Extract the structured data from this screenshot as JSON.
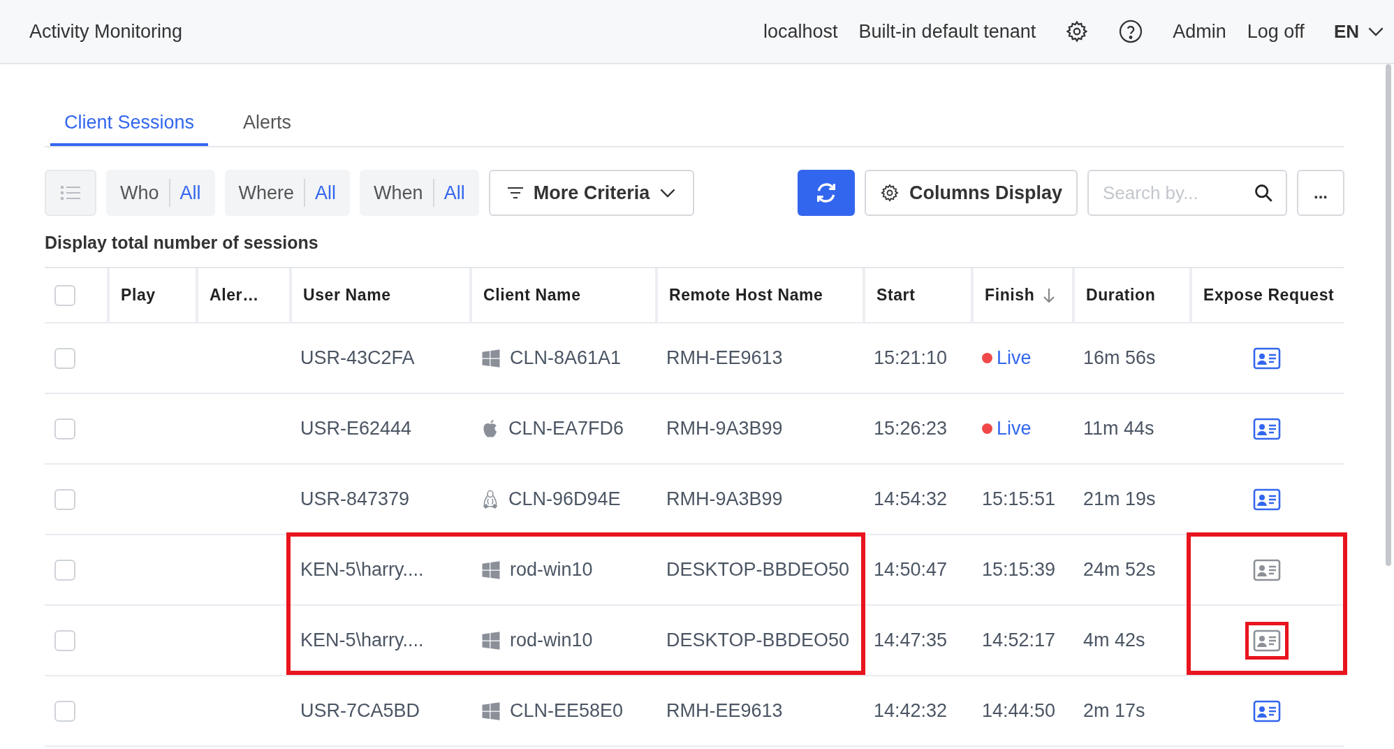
{
  "header": {
    "title": "Activity Monitoring",
    "host": "localhost",
    "tenant": "Built-in default tenant",
    "user": "Admin",
    "logoff": "Log off",
    "language": "EN"
  },
  "tabs": [
    {
      "label": "Client Sessions",
      "selected": true
    },
    {
      "label": "Alerts",
      "selected": false
    }
  ],
  "toolbar": {
    "filters": [
      {
        "label": "Who",
        "value": "All"
      },
      {
        "label": "Where",
        "value": "All"
      },
      {
        "label": "When",
        "value": "All"
      }
    ],
    "more_criteria": "More Criteria",
    "columns_display": "Columns Display",
    "search": {
      "placeholder": "Search by..."
    },
    "more": "..."
  },
  "summary": "Display total number of sessions",
  "table": {
    "select_all": {
      "checked": false
    },
    "columns": [
      {
        "kind": "play",
        "label": "Play",
        "framed": false
      },
      {
        "kind": "alert",
        "label": "Aler…",
        "framed": false
      },
      {
        "kind": "user",
        "label": "User Name",
        "framed": true
      },
      {
        "kind": "client",
        "label": "Client Name",
        "framed": true
      },
      {
        "kind": "remote",
        "label": "Remote Host Name",
        "framed": true
      },
      {
        "kind": "start",
        "label": "Start",
        "framed": false
      },
      {
        "kind": "finish",
        "label": "Finish",
        "sorted": true,
        "framed": false
      },
      {
        "kind": "duration",
        "label": "Duration",
        "framed": false
      },
      {
        "kind": "expose",
        "label": "Expose Request",
        "framed": true
      }
    ],
    "rows": [
      {
        "checked": false,
        "user": "USR-43C2FA",
        "kind": "windows",
        "client": "CLN-8A61A1",
        "remote": "RMH-EE9613",
        "start": "15:21:10",
        "finish": "Live",
        "live": true,
        "duration": "16m 56s",
        "expose_enabled": true,
        "framed": false,
        "icon_framed": false
      },
      {
        "checked": false,
        "user": "USR-E62444",
        "kind": "apple",
        "client": "CLN-EA7FD6",
        "remote": "RMH-9A3B99",
        "start": "15:26:23",
        "finish": "Live",
        "live": true,
        "duration": "11m 44s",
        "expose_enabled": true,
        "framed": false,
        "icon_framed": false
      },
      {
        "checked": false,
        "user": "USR-847379",
        "kind": "linux",
        "client": "CLN-96D94E",
        "remote": "RMH-9A3B99",
        "start": "14:54:32",
        "finish": "15:15:51",
        "live": false,
        "duration": "21m 19s",
        "expose_enabled": true,
        "framed": false,
        "icon_framed": false
      },
      {
        "checked": false,
        "user": "KEN-5\\harry....",
        "kind": "windows",
        "client": "rod-win10",
        "remote": "DESKTOP-BBDEO50",
        "start": "14:50:47",
        "finish": "15:15:39",
        "live": false,
        "duration": "24m 52s",
        "expose_enabled": false,
        "framed": true,
        "icon_framed": false
      },
      {
        "checked": false,
        "user": "KEN-5\\harry....",
        "kind": "windows",
        "client": "rod-win10",
        "remote": "DESKTOP-BBDEO50",
        "start": "14:47:35",
        "finish": "14:52:17",
        "live": false,
        "duration": "4m 42s",
        "expose_enabled": false,
        "framed": true,
        "icon_framed": true
      },
      {
        "checked": false,
        "user": "USR-7CA5BD",
        "kind": "windows",
        "client": "CLN-EE58E0",
        "remote": "RMH-EE9613",
        "start": "14:42:32",
        "finish": "14:44:50",
        "live": false,
        "duration": "2m 17s",
        "expose_enabled": true,
        "framed": false,
        "icon_framed": false
      }
    ]
  }
}
